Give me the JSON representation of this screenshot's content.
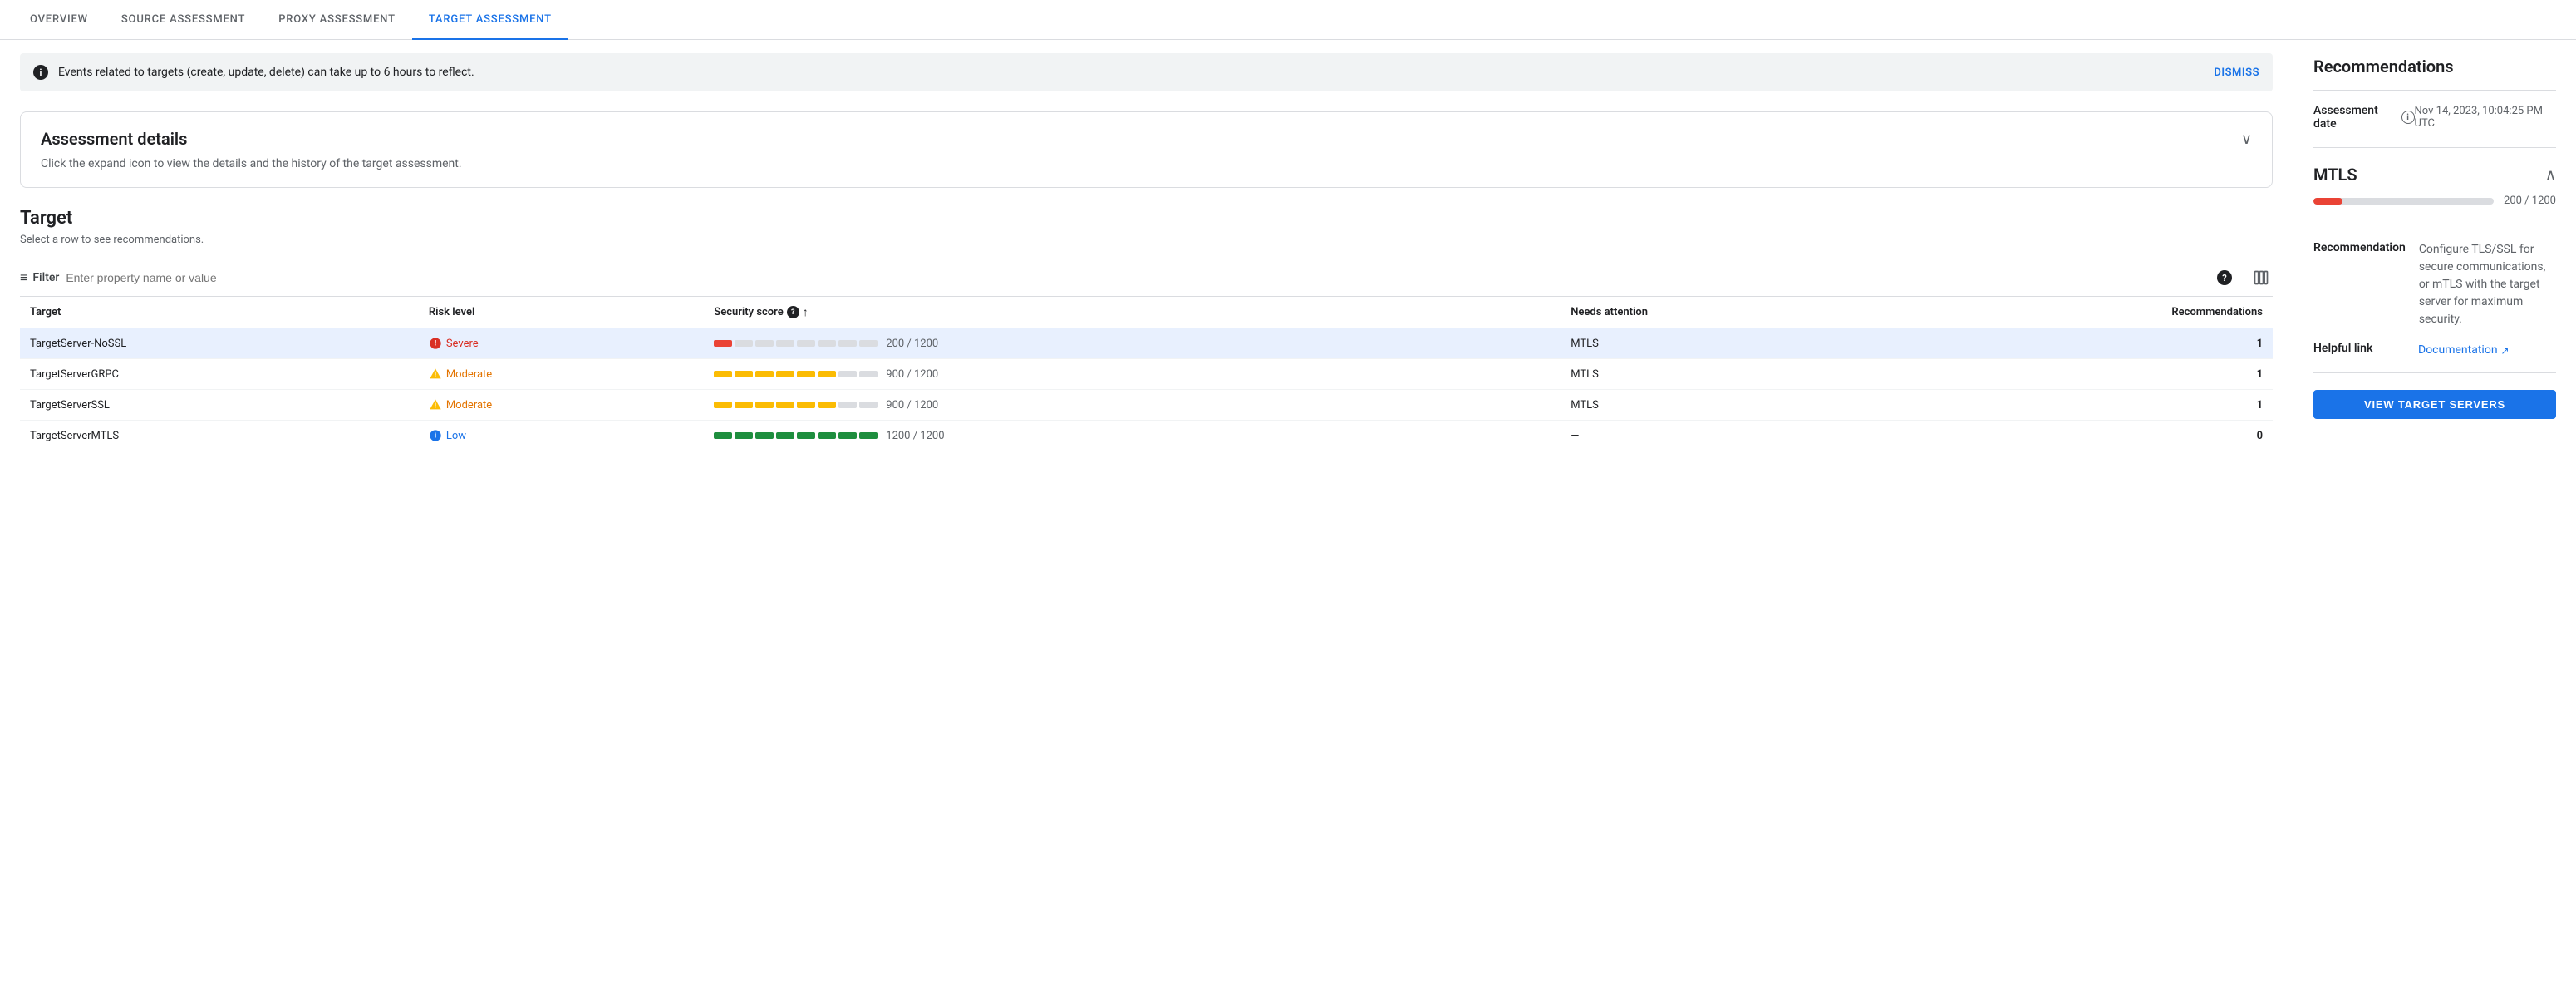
{
  "tabs": [
    {
      "id": "overview",
      "label": "OVERVIEW",
      "active": false
    },
    {
      "id": "source",
      "label": "SOURCE ASSESSMENT",
      "active": false
    },
    {
      "id": "proxy",
      "label": "PROXY ASSESSMENT",
      "active": false
    },
    {
      "id": "target",
      "label": "TARGET ASSESSMENT",
      "active": true
    }
  ],
  "banner": {
    "text": "Events related to targets (create, update, delete) can take up to 6 hours to reflect.",
    "dismiss_label": "DISMISS"
  },
  "assessment_details": {
    "title": "Assessment details",
    "description": "Click the expand icon to view the details and the history of the target assessment."
  },
  "target_section": {
    "title": "Target",
    "subtitle": "Select a row to see recommendations.",
    "filter_placeholder": "Enter property name or value",
    "filter_label": "Filter",
    "columns": {
      "target": "Target",
      "risk_level": "Risk level",
      "security_score": "Security score",
      "needs_attention": "Needs attention",
      "recommendations": "Recommendations"
    },
    "rows": [
      {
        "id": 1,
        "target": "TargetServer-NoSSL",
        "risk_level": "Severe",
        "risk_type": "severe",
        "score_value": 200,
        "score_max": 1200,
        "score_display": "200 / 1200",
        "score_segments": [
          1,
          0,
          0,
          0,
          0,
          0,
          0,
          0
        ],
        "score_color": "#ea4335",
        "needs_attention": "MTLS",
        "recommendations": "1",
        "selected": true
      },
      {
        "id": 2,
        "target": "TargetServerGRPC",
        "risk_level": "Moderate",
        "risk_type": "moderate",
        "score_value": 900,
        "score_max": 1200,
        "score_display": "900 / 1200",
        "score_segments": [
          1,
          1,
          1,
          1,
          1,
          1,
          0,
          0
        ],
        "score_color": "#fbbc04",
        "needs_attention": "MTLS",
        "recommendations": "1",
        "selected": false
      },
      {
        "id": 3,
        "target": "TargetServerSSL",
        "risk_level": "Moderate",
        "risk_type": "moderate",
        "score_value": 900,
        "score_max": 1200,
        "score_display": "900 / 1200",
        "score_segments": [
          1,
          1,
          1,
          1,
          1,
          1,
          0,
          0
        ],
        "score_color": "#fbbc04",
        "needs_attention": "MTLS",
        "recommendations": "1",
        "selected": false
      },
      {
        "id": 4,
        "target": "TargetServerMTLS",
        "risk_level": "Low",
        "risk_type": "low",
        "score_value": 1200,
        "score_max": 1200,
        "score_display": "1200 / 1200",
        "score_segments": [
          1,
          1,
          1,
          1,
          1,
          1,
          1,
          1
        ],
        "score_color": "#1e8e3e",
        "needs_attention": "—",
        "recommendations": "0",
        "selected": false
      }
    ]
  },
  "sidebar": {
    "title": "Recommendations",
    "assessment_date_label": "Assessment date",
    "assessment_date_value": "Nov 14, 2023, 10:04:25 PM UTC",
    "mtls": {
      "title": "MTLS",
      "score_display": "200 / 1200",
      "score_percent": 16,
      "bar_color": "#ea4335",
      "recommendation_label": "Recommendation",
      "recommendation_text": "Configure TLS/SSL for secure communications, or mTLS with the target server for maximum security.",
      "helpful_link_label": "Helpful link",
      "helpful_link_text": "Documentation",
      "helpful_link_url": "#"
    },
    "view_button_label": "VIEW TARGET SERVERS"
  },
  "icons": {
    "info": "ℹ",
    "chevron_down": "∨",
    "chevron_up": "∧",
    "sort_up": "↑",
    "filter": "≡",
    "help": "?",
    "columns": "|||",
    "external_link": "↗",
    "severe_icon": "🔴",
    "moderate_icon": "⚠",
    "low_icon": "ℹ"
  }
}
